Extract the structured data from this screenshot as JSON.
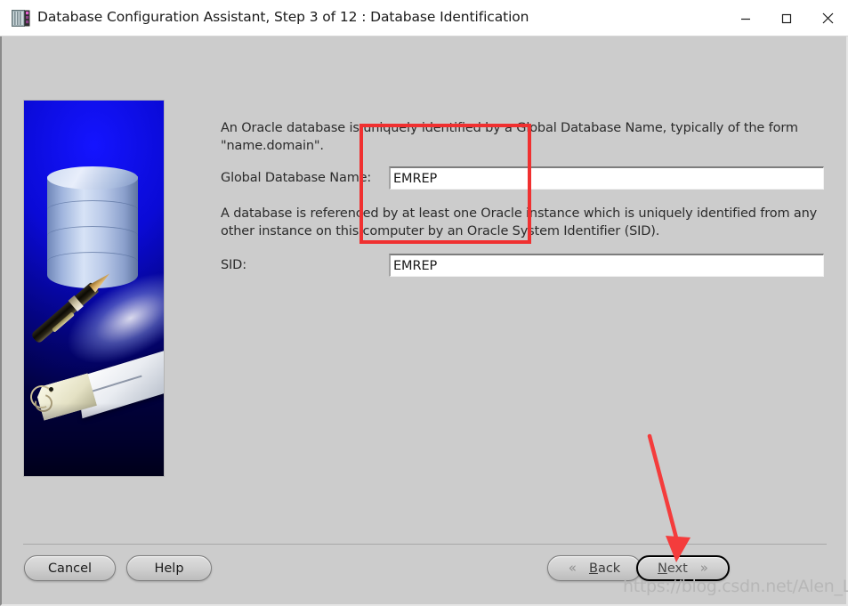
{
  "window": {
    "title": "Database Configuration Assistant, Step 3 of 12 : Database Identification",
    "icon": "database-config-icon",
    "controls": {
      "minimize": "minimize-icon",
      "maximize": "maximize-icon",
      "close": "close-icon"
    }
  },
  "splash": {
    "alt": "oracle-database-pen-tag-illustration"
  },
  "content": {
    "paragraph1": "An Oracle database is uniquely identified by a Global Database Name, typically of the form \"name.domain\".",
    "global_db_name": {
      "label": "Global Database Name:",
      "value": "EMREP",
      "placeholder": ""
    },
    "paragraph2": "A database is referenced by at least one Oracle instance which is uniquely identified from any other instance on this computer by an Oracle System Identifier (SID).",
    "sid": {
      "label": "SID:",
      "value": "EMREP",
      "placeholder": ""
    }
  },
  "footer": {
    "cancel": "Cancel",
    "help": "Help",
    "back": "Back",
    "back_mnemonic": "B",
    "back_rest": "ack",
    "next": "Next",
    "next_mnemonic": "N",
    "next_rest": "ext",
    "back_chevron": "«",
    "next_chevron": "»"
  },
  "annotations": {
    "highlight_rect": "red-rectangle-around-name-fields",
    "arrow": "red-arrow-pointing-to-next-button",
    "accent_color": "#f03030"
  },
  "watermark": {
    "text": "https://blog.csdn.net/Alen_Liu_SZ"
  }
}
